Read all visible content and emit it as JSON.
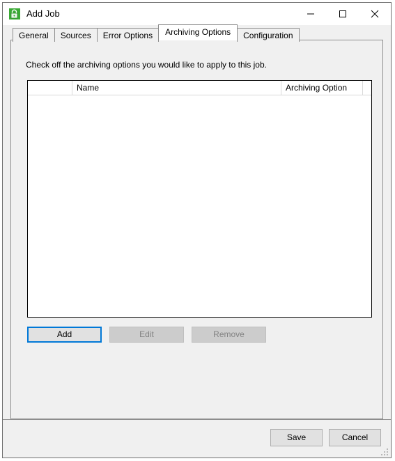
{
  "window": {
    "title": "Add Job",
    "icon": "lock-app-icon",
    "controls": [
      {
        "name": "minimize",
        "glyph": "minimize-icon"
      },
      {
        "name": "maximize",
        "glyph": "maximize-icon"
      },
      {
        "name": "close",
        "glyph": "close-icon"
      }
    ]
  },
  "tabs": [
    {
      "label": "General",
      "selected": false
    },
    {
      "label": "Sources",
      "selected": false
    },
    {
      "label": "Error Options",
      "selected": false
    },
    {
      "label": "Archiving Options",
      "selected": true
    },
    {
      "label": "Configuration",
      "selected": false
    }
  ],
  "panel": {
    "instruction": "Check off the archiving options you would like to apply to this job.",
    "list": {
      "columns": [
        {
          "label": "",
          "key": "check"
        },
        {
          "label": "Name",
          "key": "name"
        },
        {
          "label": "Archiving Option",
          "key": "option"
        },
        {
          "label": "",
          "key": "tail"
        }
      ],
      "rows": []
    },
    "buttons": [
      {
        "label": "Add",
        "state": "default"
      },
      {
        "label": "Edit",
        "state": "disabled"
      },
      {
        "label": "Remove",
        "state": "disabled"
      }
    ]
  },
  "footer": {
    "buttons": [
      {
        "label": "Save"
      },
      {
        "label": "Cancel"
      }
    ]
  },
  "colors": {
    "accent": "#0078d7",
    "window_bg": "#f0f0f0",
    "titlebar_bg": "#ffffff",
    "border": "#707070",
    "icon_green": "#3aaa35",
    "disabled_text": "#838383"
  }
}
